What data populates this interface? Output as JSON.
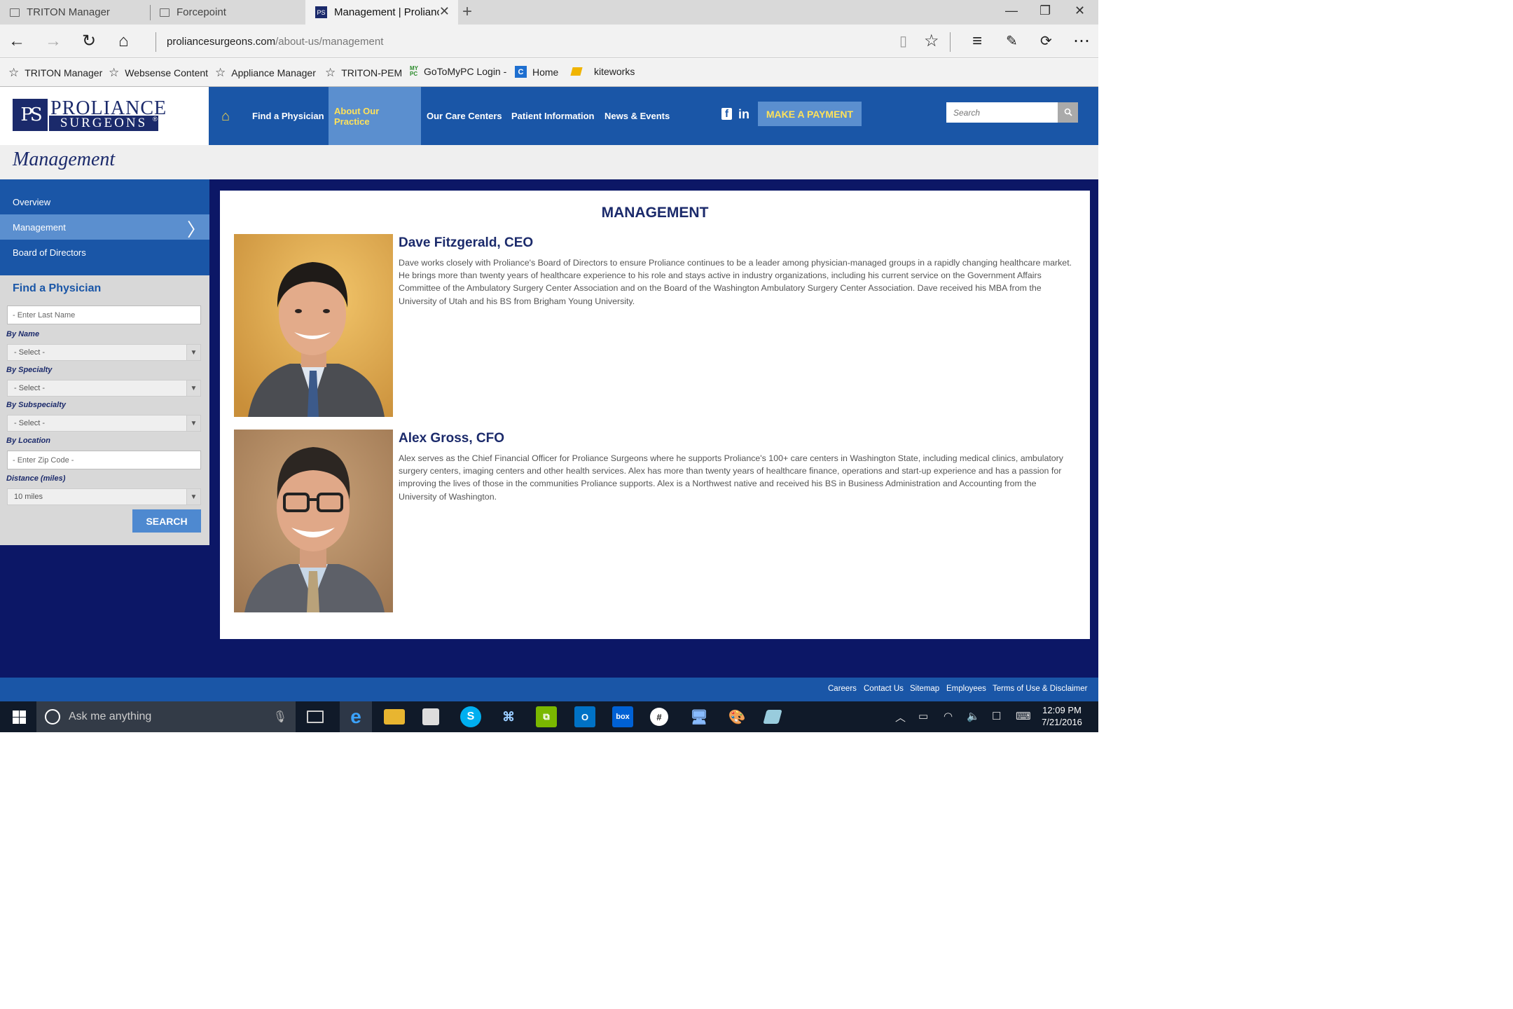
{
  "browser": {
    "tabs": [
      {
        "title": "TRITON Manager"
      },
      {
        "title": "Forcepoint"
      },
      {
        "title": "Management | Proliance"
      }
    ],
    "url_domain": "proliancesurgeons.com",
    "url_path": "/about-us/management",
    "favorites": [
      "TRITON Manager",
      "Websense Content",
      "Appliance Manager",
      "TRITON-PEM",
      "GoToMyPC Login -",
      "Home",
      "kiteworks"
    ]
  },
  "site": {
    "logo_line1": "PROLIANCE",
    "logo_line2": "SURGEONS",
    "logo_mark": "PS",
    "nav": [
      "Find a Physician",
      "About Our Practice",
      "Our Care Centers",
      "Patient Information",
      "News & Events"
    ],
    "nav_active": "About Our Practice",
    "pay_button": "MAKE A PAYMENT",
    "search_placeholder": "Search",
    "page_title": "Management"
  },
  "sidebar": {
    "items": [
      "Overview",
      "Management",
      "Board of Directors"
    ],
    "active": "Management",
    "finder": {
      "title": "Find a Physician",
      "last_name_placeholder": "- Enter Last Name",
      "by_name_label": "By Name",
      "by_name_value": "- Select -",
      "by_specialty_label": "By Specialty",
      "by_specialty_value": "- Select -",
      "by_subspecialty_label": "By Subspecialty",
      "by_subspecialty_value": "- Select -",
      "by_location_label": "By Location",
      "zip_placeholder": "- Enter Zip Code -",
      "distance_label": "Distance (miles)",
      "distance_value": "10 miles",
      "search_button": "SEARCH"
    }
  },
  "content": {
    "heading": "MANAGEMENT",
    "people": [
      {
        "name": "Dave Fitzgerald, CEO",
        "bio": "Dave works closely with Proliance's Board of Directors to ensure Proliance continues to be a leader among physician-managed groups in a rapidly changing healthcare market. He brings more than twenty years of healthcare experience to his role and stays active in industry organizations, including his current service on the Government Affairs Committee of the Ambulatory Surgery Center Association and on the Board of the Washington Ambulatory Surgery Center Association. Dave received his MBA from the University of Utah and his BS from Brigham Young University."
      },
      {
        "name": "Alex Gross, CFO",
        "bio": "Alex serves as the Chief Financial Officer for Proliance Surgeons where he supports Proliance's 100+ care centers in Washington State, including medical clinics, ambulatory surgery centers, imaging centers and other health services. Alex has more than twenty years of healthcare finance, operations and start-up experience and has a passion for improving the lives of those in the communities Proliance supports. Alex is a Northwest native and received his BS in Business Administration and Accounting from the University of Washington."
      }
    ]
  },
  "footer": {
    "links": [
      "Careers",
      "Contact Us",
      "Sitemap",
      "Employees",
      "Terms of Use & Disclaimer"
    ]
  },
  "taskbar": {
    "search_placeholder": "Ask me anything",
    "time": "12:09 PM",
    "date": "7/21/2016"
  },
  "colors": {
    "brand_blue": "#1a56a7",
    "accent_yellow": "#ffe25a",
    "navy": "#1b2a6b",
    "background_dark": "#0c1766"
  }
}
